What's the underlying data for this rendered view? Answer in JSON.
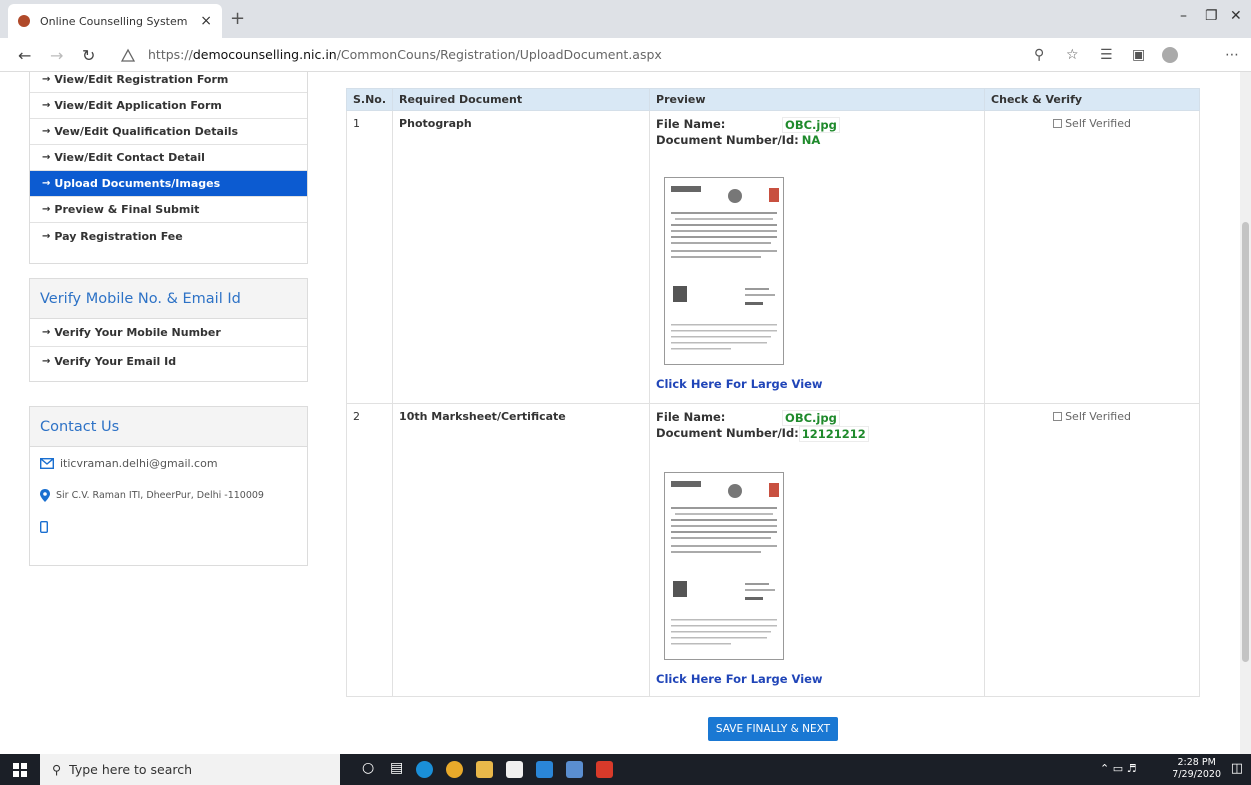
{
  "browser": {
    "tab_title": "Online Counselling System",
    "tab_close": "×",
    "new_tab": "+",
    "url_prefix": "https://",
    "url_host": "democounselling.nic.in",
    "url_path": "/CommonCouns/Registration/UploadDocument.aspx"
  },
  "sidebar": {
    "menu": [
      {
        "label": "View/Edit Registration Form"
      },
      {
        "label": "View/Edit Application Form"
      },
      {
        "label": "Vew/Edit Qualification Details"
      },
      {
        "label": "View/Edit Contact Detail"
      },
      {
        "label": "Upload Documents/Images"
      },
      {
        "label": "Preview & Final Submit"
      },
      {
        "label": "Pay Registration Fee"
      }
    ],
    "verify_title": "Verify Mobile No. & Email Id",
    "verify_items": [
      {
        "label": "Verify Your Mobile Number"
      },
      {
        "label": "Verify Your Email Id"
      }
    ],
    "contact_title": "Contact Us",
    "contact_email": "iticvraman.delhi@gmail.com",
    "contact_address": "Sir C.V. Raman ITI, DheerPur, Delhi -110009"
  },
  "table": {
    "headers": [
      "S.No.",
      "Required Document",
      "Preview",
      "Check & Verify"
    ],
    "file_label": "File Name:",
    "docnum_label": "Document Number/Id:",
    "large_view": "Click Here For Large View",
    "verify_label": "Self Verified",
    "rows": [
      {
        "sno": "1",
        "document": "Photograph",
        "file_name": "OBC.jpg",
        "doc_number": "NA"
      },
      {
        "sno": "2",
        "document": "10th Marksheet/Certificate",
        "file_name": "OBC.jpg",
        "doc_number": "12121212"
      }
    ]
  },
  "save_button": "SAVE FINALLY & NEXT",
  "taskbar": {
    "search_placeholder": "Type here to search",
    "time": "2:28 PM",
    "date": "7/29/2020"
  },
  "colors": {
    "accent": "#0c5bd1",
    "header_bg": "#d9e8f5",
    "green_value": "#1f8a2c",
    "link": "#2045b8"
  }
}
